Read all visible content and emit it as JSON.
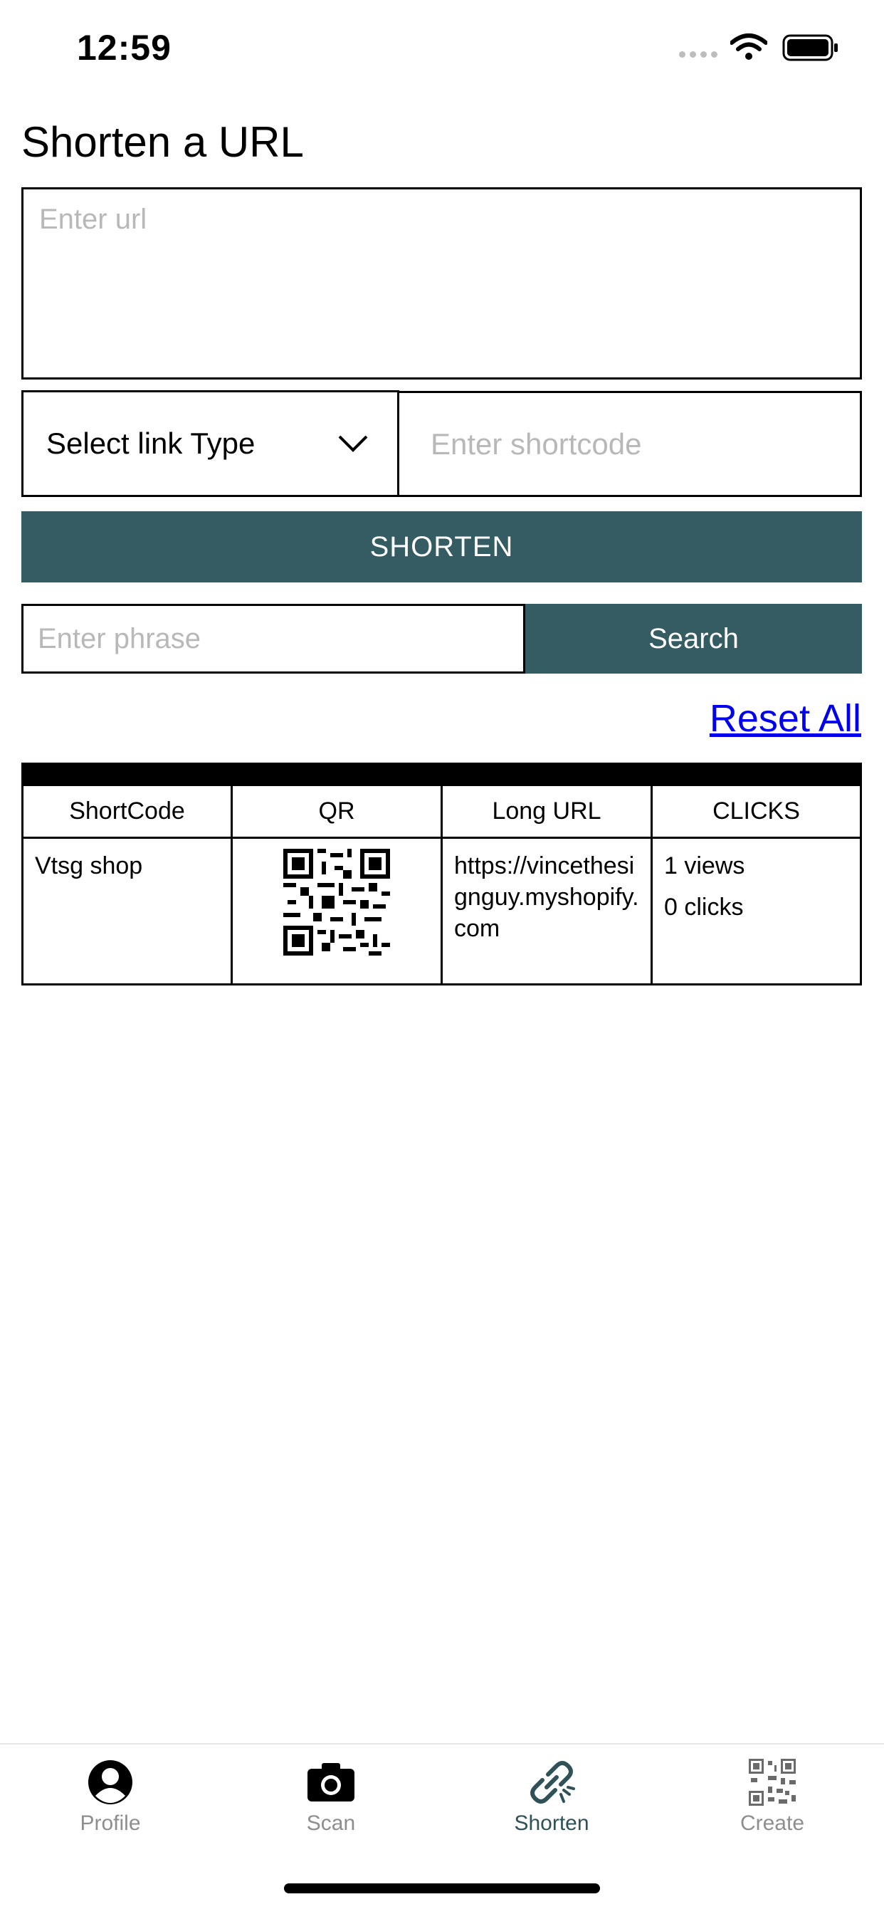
{
  "status_bar": {
    "time": "12:59"
  },
  "page": {
    "title": "Shorten a URL"
  },
  "form": {
    "url_placeholder": "Enter url",
    "link_type_label": "Select link Type",
    "shortcode_placeholder": "Enter shortcode",
    "shorten_label": "SHORTEN"
  },
  "search": {
    "phrase_placeholder": "Enter phrase",
    "button_label": "Search",
    "reset_label": "Reset All"
  },
  "table": {
    "headers": [
      "ShortCode",
      "QR",
      "Long URL",
      "CLICKS"
    ],
    "rows": [
      {
        "shortcode": "Vtsg shop",
        "long_url": "https://vincethesignguy.myshopify.com",
        "views": "1 views",
        "clicks": "0 clicks"
      }
    ]
  },
  "tabbar": {
    "items": [
      {
        "label": "Profile",
        "icon": "profile-icon"
      },
      {
        "label": "Scan",
        "icon": "camera-icon"
      },
      {
        "label": "Shorten",
        "icon": "link-icon",
        "active": true
      },
      {
        "label": "Create",
        "icon": "qr-code-icon"
      }
    ]
  },
  "colors": {
    "accent": "#355c63",
    "link": "#0000ee",
    "tab_inactive": "#8e8e8e",
    "tab_active": "#2f5157"
  }
}
